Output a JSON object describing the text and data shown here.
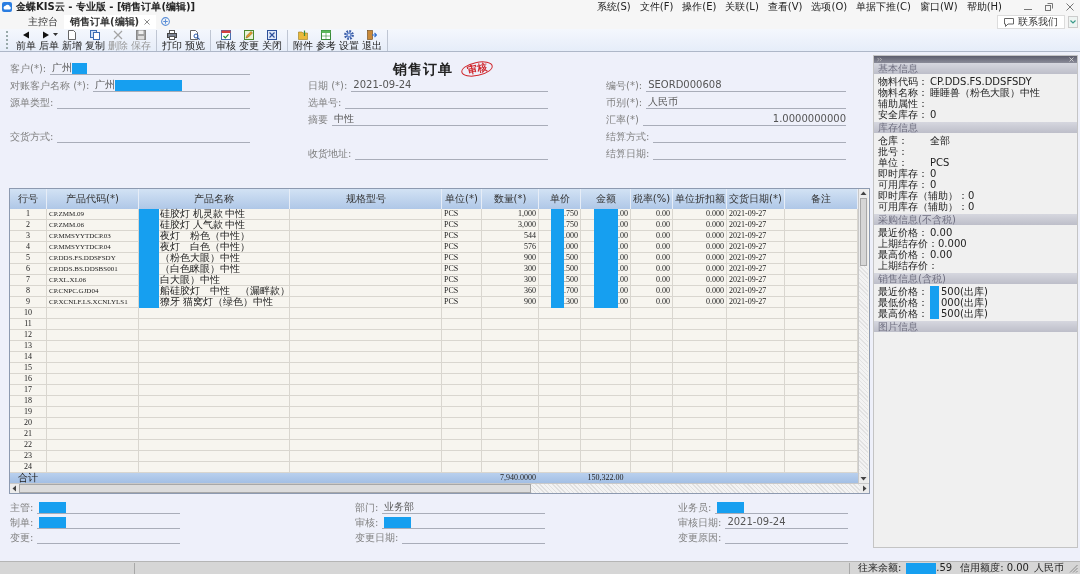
{
  "window": {
    "title": "金蝶KIS云 - 专业版 - [销售订单(编辑)]",
    "menu": [
      "系统(S)",
      "文件(F)",
      "操作(E)",
      "关联(L)",
      "查看(V)",
      "选项(O)",
      "单据下推(C)",
      "窗口(W)",
      "帮助(H)"
    ]
  },
  "tabs": [
    {
      "label": "主控台",
      "selected": false,
      "closable": false
    },
    {
      "label": "销售订单(编辑)",
      "selected": true,
      "closable": true
    }
  ],
  "contact_button": "联系我们",
  "toolbar": {
    "groups": [
      {
        "buttons": [
          {
            "label": "前单",
            "kind": "prev",
            "disabled": false,
            "dropdown": false
          },
          {
            "label": "后单",
            "kind": "next",
            "disabled": false,
            "dropdown": true
          },
          {
            "label": "新增",
            "kind": "new",
            "disabled": false,
            "dropdown": false
          },
          {
            "label": "复制",
            "kind": "copy",
            "disabled": false,
            "dropdown": false
          },
          {
            "label": "删除",
            "kind": "delete",
            "disabled": true,
            "dropdown": false
          },
          {
            "label": "保存",
            "kind": "save",
            "disabled": true,
            "dropdown": false
          }
        ]
      },
      {
        "buttons": [
          {
            "label": "打印",
            "kind": "print",
            "disabled": false,
            "dropdown": false
          },
          {
            "label": "预览",
            "kind": "preview",
            "disabled": false,
            "dropdown": false
          }
        ]
      },
      {
        "buttons": [
          {
            "label": "审核",
            "kind": "audit",
            "disabled": false,
            "dropdown": false
          },
          {
            "label": "变更",
            "kind": "change",
            "disabled": false,
            "dropdown": false
          },
          {
            "label": "关闭",
            "kind": "close",
            "disabled": false,
            "dropdown": false
          }
        ]
      },
      {
        "buttons": [
          {
            "label": "附件",
            "kind": "attach",
            "disabled": false,
            "dropdown": false
          },
          {
            "label": "参考",
            "kind": "reference",
            "disabled": false,
            "dropdown": false
          },
          {
            "label": "设置",
            "kind": "settings",
            "disabled": false,
            "dropdown": false
          },
          {
            "label": "退出",
            "kind": "exit",
            "disabled": false,
            "dropdown": false
          }
        ]
      }
    ]
  },
  "form": {
    "title": "销售订单",
    "stamp": "审核",
    "left": [
      {
        "label": "客户(*):",
        "value": "广州",
        "redacted": true
      },
      {
        "label": "对账客户名称 (*):",
        "value": "广州",
        "redacted": true
      },
      {
        "label": "源单类型:",
        "redacted": false
      },
      {
        "label": "交货方式:",
        "redacted": false
      }
    ],
    "middle": [
      {
        "label": "日期 (*):",
        "value": "2021-09-24",
        "redacted": false
      },
      {
        "label": "选单号:",
        "redacted": false
      },
      {
        "label": "摘要",
        "value": "中性",
        "redacted": false
      },
      {
        "label": "收货地址:",
        "redacted": false
      }
    ],
    "right": [
      {
        "label": "编号(*):",
        "value": "SEORD000608",
        "redacted": false
      },
      {
        "label": "币别(*):",
        "value": "人民币",
        "redacted": false
      },
      {
        "label": "汇率(*)",
        "value": "1.0000000000",
        "redacted": false
      },
      {
        "label": "结算方式:",
        "redacted": false
      },
      {
        "label": "结算日期:",
        "redacted": false
      }
    ]
  },
  "table": {
    "columns": [
      "行号",
      "产品代码(*)",
      "产品名称",
      "规格型号",
      "单位(*)",
      "数量(*)",
      "单价",
      "金额",
      "税率(%)",
      "单位折扣额",
      "交货日期(*)",
      "备注"
    ],
    "rows": [
      {
        "row_no": "1",
        "code": "CP.ZMM.09",
        "name": "硅胶灯 机灵款 中性",
        "unit": "PCS",
        "quantity": "1,000",
        "price": ".750",
        "amount": ".00",
        "tax_rate": "0.00",
        "discount": "0.000",
        "delivery_date": "2021-09-27",
        "redacted": true
      },
      {
        "row_no": "2",
        "code": "CP.ZMM.06",
        "name": "硅胶灯 人气款 中性",
        "unit": "PCS",
        "quantity": "3,000",
        "price": ".750",
        "amount": ".00",
        "tax_rate": "0.00",
        "discount": "0.000",
        "delivery_date": "2021-09-27",
        "redacted": true
      },
      {
        "row_no": "3",
        "code": "CP.MMSYYTDCP.03",
        "name": "夜灯　粉色（中性）",
        "unit": "PCS",
        "quantity": "544",
        "price": ".000",
        "amount": ".00",
        "tax_rate": "0.00",
        "discount": "0.000",
        "delivery_date": "2021-09-27",
        "redacted": true
      },
      {
        "row_no": "4",
        "code": "CP.MMSYYTDCP.04",
        "name": "夜灯　白色（中性）",
        "unit": "PCS",
        "quantity": "576",
        "price": ".000",
        "amount": ".00",
        "tax_rate": "0.00",
        "discount": "0.000",
        "delivery_date": "2021-09-27",
        "redacted": true
      },
      {
        "row_no": "5",
        "code": "CP.DDS.FS.DDSFSDY",
        "name": "（粉色大眼）中性",
        "unit": "PCS",
        "quantity": "900",
        "price": ".500",
        "amount": ".00",
        "tax_rate": "0.00",
        "discount": "0.000",
        "delivery_date": "2021-09-27",
        "redacted": true
      },
      {
        "row_no": "6",
        "code": "CP.DDS.BS.DDSBS001",
        "name": "（白色眯眼）中性",
        "unit": "PCS",
        "quantity": "300",
        "price": ".500",
        "amount": ".00",
        "tax_rate": "0.00",
        "discount": "0.000",
        "delivery_date": "2021-09-27",
        "redacted": true
      },
      {
        "row_no": "7",
        "code": "CP.XL.XL06",
        "name": "白大眼）中性",
        "unit": "PCS",
        "quantity": "300",
        "price": ".500",
        "amount": ".00",
        "tax_rate": "0.00",
        "discount": "0.000",
        "delivery_date": "2021-09-27",
        "redacted": true
      },
      {
        "row_no": "8",
        "code": "CP.CNPC.GJD04",
        "name": "船硅胶灯　中性　（漏畔款）",
        "unit": "PCS",
        "quantity": "360",
        "price": ".700",
        "amount": ".00",
        "tax_rate": "0.00",
        "discount": "0.000",
        "delivery_date": "2021-09-27",
        "redacted": true
      },
      {
        "row_no": "9",
        "code": "CP.XCNLF.LS.XCNLYLS1",
        "name": "獠牙 猫窝灯（绿色）中性",
        "unit": "PCS",
        "quantity": "900",
        "price": ".300",
        "amount": ".00",
        "tax_rate": "0.00",
        "discount": "0.000",
        "delivery_date": "2021-09-27",
        "redacted": true
      },
      {
        "row_no": "10"
      },
      {
        "row_no": "11"
      },
      {
        "row_no": "12"
      },
      {
        "row_no": "13"
      },
      {
        "row_no": "14"
      },
      {
        "row_no": "15"
      },
      {
        "row_no": "16"
      },
      {
        "row_no": "17"
      },
      {
        "row_no": "18"
      },
      {
        "row_no": "19"
      },
      {
        "row_no": "20"
      },
      {
        "row_no": "21"
      },
      {
        "row_no": "22"
      },
      {
        "row_no": "23"
      },
      {
        "row_no": "24"
      }
    ],
    "total": {
      "label": "合计",
      "quantity": "7,940.0000",
      "amount": "150,322.00"
    }
  },
  "footer_form": {
    "left": [
      {
        "label": "主管:",
        "redacted": true
      },
      {
        "label": "制单:",
        "redacted": true
      },
      {
        "label": "变更:",
        "redacted": false
      }
    ],
    "middle": [
      {
        "label": "部门:",
        "value": "业务部",
        "redacted": false
      },
      {
        "label": "审核:",
        "redacted": true
      },
      {
        "label": "变更日期:",
        "redacted": false
      }
    ],
    "right": [
      {
        "label": "业务员:",
        "redacted": true
      },
      {
        "label": "审核日期:",
        "value": "2021-09-24",
        "redacted": false
      },
      {
        "label": "变更原因:",
        "redacted": false
      }
    ]
  },
  "info_panel": {
    "sections": [
      {
        "title": "基本信息",
        "rows": [
          {
            "label": "物料代码：",
            "value": "CP.DDS.FS.DDSFSDY"
          },
          {
            "label": "物料名称：",
            "value": "睡睡兽（粉色大眼）中性"
          },
          {
            "label": "辅助属性："
          },
          {
            "label": "安全库存：",
            "value": "0"
          }
        ]
      },
      {
        "title": "库存信息",
        "rows": [
          {
            "label": "仓库：",
            "value": "全部"
          },
          {
            "label": "批号："
          },
          {
            "label": "单位：",
            "value": "PCS"
          },
          {
            "label": "即时库存：",
            "value": "0"
          },
          {
            "label": "可用库存：",
            "value": "0"
          },
          {
            "label": "即时库存（辅助）：",
            "value": "0"
          },
          {
            "label": "可用库存（辅助）：",
            "value": "0"
          }
        ]
      },
      {
        "title": "采购信息(不含税)",
        "rows": [
          {
            "label": "最近价格：",
            "value": "0.00"
          },
          {
            "label": "上期结存价：",
            "value": "0.000"
          },
          {
            "label": "最高价格：",
            "value": "0.00"
          },
          {
            "label": "上期结存价："
          }
        ]
      },
      {
        "title": "销售信息(含税)",
        "rows": [
          {
            "label": "最近价格：",
            "value": "500(出库)",
            "redacted": true
          },
          {
            "label": "最低价格：",
            "value": "000(出库)",
            "redacted": true
          },
          {
            "label": "最高价格：",
            "value": "500(出库)",
            "redacted": true
          }
        ]
      },
      {
        "title": "图片信息"
      }
    ]
  },
  "status_bar": {
    "balance_label": "往来余额:",
    "balance_value": ".59",
    "balance_redacted": true,
    "credit": "信用额度: 0.00",
    "currency": "人民币"
  }
}
